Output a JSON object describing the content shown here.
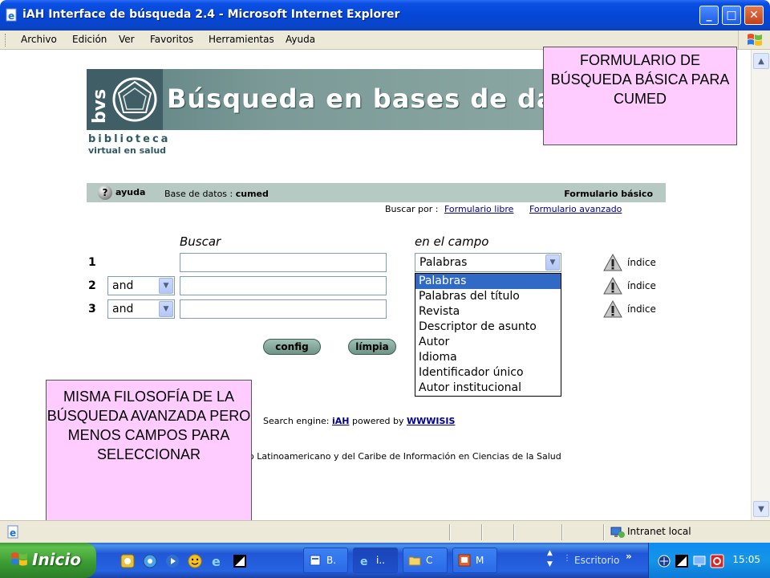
{
  "window": {
    "title": "iAH Interface de búsqueda 2.4 - Microsoft Internet Explorer",
    "minimize_label": "_",
    "maximize_label": "□",
    "close_label": "✕"
  },
  "menu": {
    "items": [
      "Archivo",
      "Edición",
      "Ver",
      "Favoritos",
      "Herramientas",
      "Ayuda"
    ]
  },
  "banner": {
    "logo_text": "bvs",
    "title": "Búsqueda en bases de datos",
    "caption_line1": "biblioteca",
    "caption_line2": "virtual en salud"
  },
  "formbar": {
    "help_label": "ayuda",
    "db_label": "Base de datos :",
    "db_name": "cumed",
    "form_name": "Formulario básico"
  },
  "search_by": {
    "label": "Buscar por :",
    "free_form": "Formulario libre",
    "advanced_form": "Formulario avanzado"
  },
  "columns": {
    "search": "Buscar",
    "field": "en el campo"
  },
  "rows": [
    {
      "num": "1",
      "operator": "",
      "field": "Palabras",
      "index_label": "índice"
    },
    {
      "num": "2",
      "operator": "and",
      "field": "",
      "index_label": "índice"
    },
    {
      "num": "3",
      "operator": "and",
      "field": "",
      "index_label": "índice"
    }
  ],
  "field_options": [
    "Palabras",
    "Palabras del título",
    "Revista",
    "Descriptor de asunto",
    "Autor",
    "Idioma",
    "Identificador único",
    "Autor institucional"
  ],
  "buttons": {
    "config": "config",
    "clear": "límpia"
  },
  "engine": {
    "prefix": "Search engine:",
    "iah": "iAH",
    "powered_by": "powered by",
    "wwwisis": "WWWISIS"
  },
  "footer": {
    "text": "o Latinoamericano y del Caribe de Información en Ciencias de la Salud"
  },
  "callouts": {
    "top": "FORMULARIO DE BÚSQUEDA BÁSICA PARA CUMED",
    "bottom": "MISMA FILOSOFÍA DE LA BÚSQUEDA AVANZADA PERO MENOS CAMPOS PARA SELECCIONAR"
  },
  "statusbar": {
    "zone": "Intranet local"
  },
  "taskbar": {
    "start_label": "Inicio",
    "tasks": [
      {
        "label": "B."
      },
      {
        "label": "i.."
      },
      {
        "label": "C"
      },
      {
        "label": "M"
      }
    ],
    "desktop_label": "Escritorio",
    "clock": "15:05"
  },
  "colors": {
    "titlebar": "#0546d6",
    "callout_bg": "#ffccff",
    "formbar_bg": "#b7c9c3",
    "link": "#00008b",
    "selection": "#316ac5"
  }
}
